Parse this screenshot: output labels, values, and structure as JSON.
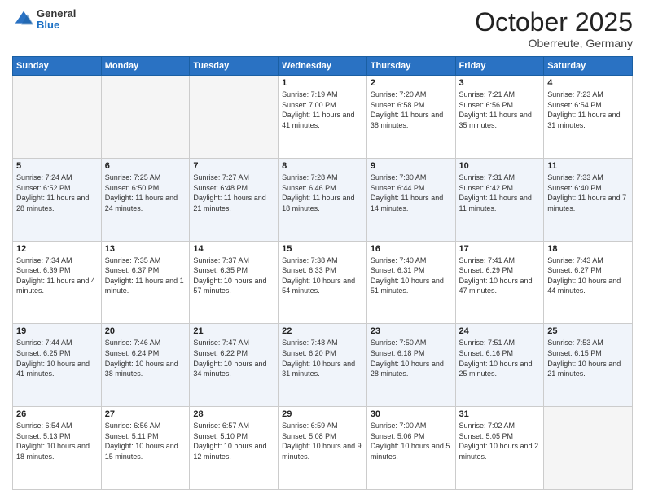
{
  "header": {
    "logo": {
      "general": "General",
      "blue": "Blue"
    },
    "title": "October 2025",
    "subtitle": "Oberreute, Germany"
  },
  "weekdays": [
    "Sunday",
    "Monday",
    "Tuesday",
    "Wednesday",
    "Thursday",
    "Friday",
    "Saturday"
  ],
  "weeks": [
    [
      {
        "day": "",
        "sunrise": "",
        "sunset": "",
        "daylight": ""
      },
      {
        "day": "",
        "sunrise": "",
        "sunset": "",
        "daylight": ""
      },
      {
        "day": "",
        "sunrise": "",
        "sunset": "",
        "daylight": ""
      },
      {
        "day": "1",
        "sunrise": "Sunrise: 7:19 AM",
        "sunset": "Sunset: 7:00 PM",
        "daylight": "Daylight: 11 hours and 41 minutes."
      },
      {
        "day": "2",
        "sunrise": "Sunrise: 7:20 AM",
        "sunset": "Sunset: 6:58 PM",
        "daylight": "Daylight: 11 hours and 38 minutes."
      },
      {
        "day": "3",
        "sunrise": "Sunrise: 7:21 AM",
        "sunset": "Sunset: 6:56 PM",
        "daylight": "Daylight: 11 hours and 35 minutes."
      },
      {
        "day": "4",
        "sunrise": "Sunrise: 7:23 AM",
        "sunset": "Sunset: 6:54 PM",
        "daylight": "Daylight: 11 hours and 31 minutes."
      }
    ],
    [
      {
        "day": "5",
        "sunrise": "Sunrise: 7:24 AM",
        "sunset": "Sunset: 6:52 PM",
        "daylight": "Daylight: 11 hours and 28 minutes."
      },
      {
        "day": "6",
        "sunrise": "Sunrise: 7:25 AM",
        "sunset": "Sunset: 6:50 PM",
        "daylight": "Daylight: 11 hours and 24 minutes."
      },
      {
        "day": "7",
        "sunrise": "Sunrise: 7:27 AM",
        "sunset": "Sunset: 6:48 PM",
        "daylight": "Daylight: 11 hours and 21 minutes."
      },
      {
        "day": "8",
        "sunrise": "Sunrise: 7:28 AM",
        "sunset": "Sunset: 6:46 PM",
        "daylight": "Daylight: 11 hours and 18 minutes."
      },
      {
        "day": "9",
        "sunrise": "Sunrise: 7:30 AM",
        "sunset": "Sunset: 6:44 PM",
        "daylight": "Daylight: 11 hours and 14 minutes."
      },
      {
        "day": "10",
        "sunrise": "Sunrise: 7:31 AM",
        "sunset": "Sunset: 6:42 PM",
        "daylight": "Daylight: 11 hours and 11 minutes."
      },
      {
        "day": "11",
        "sunrise": "Sunrise: 7:33 AM",
        "sunset": "Sunset: 6:40 PM",
        "daylight": "Daylight: 11 hours and 7 minutes."
      }
    ],
    [
      {
        "day": "12",
        "sunrise": "Sunrise: 7:34 AM",
        "sunset": "Sunset: 6:39 PM",
        "daylight": "Daylight: 11 hours and 4 minutes."
      },
      {
        "day": "13",
        "sunrise": "Sunrise: 7:35 AM",
        "sunset": "Sunset: 6:37 PM",
        "daylight": "Daylight: 11 hours and 1 minute."
      },
      {
        "day": "14",
        "sunrise": "Sunrise: 7:37 AM",
        "sunset": "Sunset: 6:35 PM",
        "daylight": "Daylight: 10 hours and 57 minutes."
      },
      {
        "day": "15",
        "sunrise": "Sunrise: 7:38 AM",
        "sunset": "Sunset: 6:33 PM",
        "daylight": "Daylight: 10 hours and 54 minutes."
      },
      {
        "day": "16",
        "sunrise": "Sunrise: 7:40 AM",
        "sunset": "Sunset: 6:31 PM",
        "daylight": "Daylight: 10 hours and 51 minutes."
      },
      {
        "day": "17",
        "sunrise": "Sunrise: 7:41 AM",
        "sunset": "Sunset: 6:29 PM",
        "daylight": "Daylight: 10 hours and 47 minutes."
      },
      {
        "day": "18",
        "sunrise": "Sunrise: 7:43 AM",
        "sunset": "Sunset: 6:27 PM",
        "daylight": "Daylight: 10 hours and 44 minutes."
      }
    ],
    [
      {
        "day": "19",
        "sunrise": "Sunrise: 7:44 AM",
        "sunset": "Sunset: 6:25 PM",
        "daylight": "Daylight: 10 hours and 41 minutes."
      },
      {
        "day": "20",
        "sunrise": "Sunrise: 7:46 AM",
        "sunset": "Sunset: 6:24 PM",
        "daylight": "Daylight: 10 hours and 38 minutes."
      },
      {
        "day": "21",
        "sunrise": "Sunrise: 7:47 AM",
        "sunset": "Sunset: 6:22 PM",
        "daylight": "Daylight: 10 hours and 34 minutes."
      },
      {
        "day": "22",
        "sunrise": "Sunrise: 7:48 AM",
        "sunset": "Sunset: 6:20 PM",
        "daylight": "Daylight: 10 hours and 31 minutes."
      },
      {
        "day": "23",
        "sunrise": "Sunrise: 7:50 AM",
        "sunset": "Sunset: 6:18 PM",
        "daylight": "Daylight: 10 hours and 28 minutes."
      },
      {
        "day": "24",
        "sunrise": "Sunrise: 7:51 AM",
        "sunset": "Sunset: 6:16 PM",
        "daylight": "Daylight: 10 hours and 25 minutes."
      },
      {
        "day": "25",
        "sunrise": "Sunrise: 7:53 AM",
        "sunset": "Sunset: 6:15 PM",
        "daylight": "Daylight: 10 hours and 21 minutes."
      }
    ],
    [
      {
        "day": "26",
        "sunrise": "Sunrise: 6:54 AM",
        "sunset": "Sunset: 5:13 PM",
        "daylight": "Daylight: 10 hours and 18 minutes."
      },
      {
        "day": "27",
        "sunrise": "Sunrise: 6:56 AM",
        "sunset": "Sunset: 5:11 PM",
        "daylight": "Daylight: 10 hours and 15 minutes."
      },
      {
        "day": "28",
        "sunrise": "Sunrise: 6:57 AM",
        "sunset": "Sunset: 5:10 PM",
        "daylight": "Daylight: 10 hours and 12 minutes."
      },
      {
        "day": "29",
        "sunrise": "Sunrise: 6:59 AM",
        "sunset": "Sunset: 5:08 PM",
        "daylight": "Daylight: 10 hours and 9 minutes."
      },
      {
        "day": "30",
        "sunrise": "Sunrise: 7:00 AM",
        "sunset": "Sunset: 5:06 PM",
        "daylight": "Daylight: 10 hours and 5 minutes."
      },
      {
        "day": "31",
        "sunrise": "Sunrise: 7:02 AM",
        "sunset": "Sunset: 5:05 PM",
        "daylight": "Daylight: 10 hours and 2 minutes."
      },
      {
        "day": "",
        "sunrise": "",
        "sunset": "",
        "daylight": ""
      }
    ]
  ]
}
